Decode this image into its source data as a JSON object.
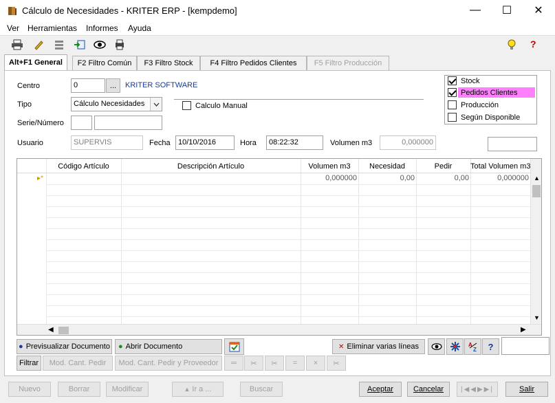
{
  "window": {
    "title": "Cálculo de Necesidades - KRITER ERP - [kempdemo]",
    "minimize": "—",
    "maximize": "☐",
    "close": "✕"
  },
  "menu": [
    "Ver",
    "Herramientas",
    "Informes",
    "Ayuda"
  ],
  "toolbar_icons": [
    "printer-icon",
    "pen-icon",
    "stack-icon",
    "export-icon",
    "eye-icon",
    "print-preview-icon",
    "lightbulb-icon",
    "help-icon"
  ],
  "tabs": [
    {
      "label": "Alt+F1 General",
      "active": true
    },
    {
      "label": "F2 Filtro Común"
    },
    {
      "label": "F3 Filtro Stock"
    },
    {
      "label": "F4 Filtro Pedidos Clientes"
    },
    {
      "label": "F5 Filtro Producción",
      "disabled": true
    }
  ],
  "form": {
    "centro_label": "Centro",
    "centro_value": "0",
    "centro_button": "...",
    "centro_name": "KRITER SOFTWARE",
    "tipo_label": "Tipo",
    "tipo_value": "Cálculo Necesidades",
    "calculo_manual": "Calculo Manual",
    "serie_label": "Serie/Número",
    "usuario_label": "Usuario",
    "usuario_value": "SUPERVIS",
    "fecha_label": "Fecha",
    "fecha_value": "10/10/2016",
    "hora_label": "Hora",
    "hora_value": "08:22:32",
    "volumen_label": "Volumen m3",
    "volumen_value": "0,000000"
  },
  "options": [
    {
      "label": "Stock",
      "checked": true
    },
    {
      "label": "Pedidos Clientes",
      "checked": true
    },
    {
      "label": "Producción",
      "checked": false
    },
    {
      "label": "Según Disponible",
      "checked": false
    }
  ],
  "grid": {
    "columns": [
      "Código Artículo",
      "Descripción Artículo",
      "Volumen m3",
      "Necesidad",
      "Pedir",
      "Total Volumen m3"
    ],
    "row": [
      "",
      "",
      "0,000000",
      "0,00",
      "0,00",
      "0,000000"
    ]
  },
  "actions": {
    "previsualizar": "Previsualizar Documento",
    "abrir": "Abrir Documento",
    "eliminar": "Eliminar varias líneas",
    "filtrar": "Filtrar",
    "mod_cant_pedir": "Mod. Cant. Pedir",
    "mod_cant_pedir_prov": "Mod. Cant. Pedir y Proveedor"
  },
  "bottom": {
    "nuevo": "Nuevo",
    "borrar": "Borrar",
    "modificar": "Modificar",
    "ir_a": "Ir a ...",
    "buscar": "Buscar",
    "aceptar": "Aceptar",
    "cancelar": "Cancelar",
    "salir": "Salir"
  }
}
